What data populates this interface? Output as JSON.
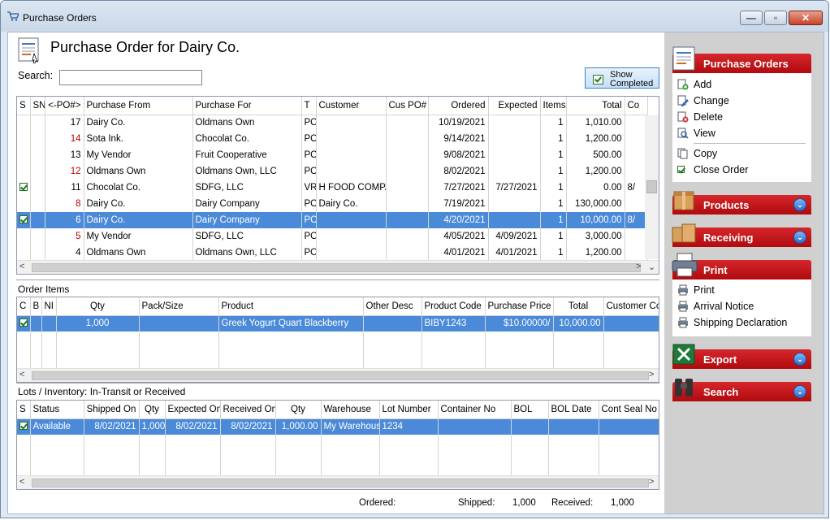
{
  "window": {
    "title": "Purchase Orders"
  },
  "header": {
    "title": "Purchase Order for Dairy Co."
  },
  "search": {
    "label": "Search:",
    "value": ""
  },
  "show_completed": {
    "label_line1": "Show",
    "label_line2": "Completed",
    "checked": true
  },
  "po_grid": {
    "columns": [
      "S",
      "SN",
      "<-PO#>",
      "Purchase From",
      "Purchase For",
      "T",
      "Customer",
      "Cus PO#",
      "Ordered",
      "Expected",
      "Items",
      "Total",
      "Co"
    ],
    "rows": [
      {
        "s": "",
        "sn": "",
        "po": "17",
        "from": "Dairy Co.",
        "for": "Oldmans Own",
        "t": "PO",
        "customer": "",
        "cuspo": "",
        "ordered": "10/19/2021",
        "expected": "",
        "items": "1",
        "total": "1,010.00",
        "co": "",
        "red": false,
        "checked": false,
        "selected": false
      },
      {
        "s": "",
        "sn": "",
        "po": "14",
        "from": "Sota Ink.",
        "for": "Chocolat Co.",
        "t": "PO",
        "customer": "",
        "cuspo": "",
        "ordered": "9/14/2021",
        "expected": "",
        "items": "1",
        "total": "1,200.00",
        "co": "",
        "red": true,
        "checked": false,
        "selected": false
      },
      {
        "s": "",
        "sn": "",
        "po": "13",
        "from": "My Vendor",
        "for": "Fruit Cooperative",
        "t": "PO",
        "customer": "",
        "cuspo": "",
        "ordered": "9/08/2021",
        "expected": "",
        "items": "1",
        "total": "500.00",
        "co": "",
        "red": false,
        "checked": false,
        "selected": false
      },
      {
        "s": "",
        "sn": "",
        "po": "12",
        "from": "Oldmans Own",
        "for": "Oldmans Own, LLC",
        "t": "PO",
        "customer": "",
        "cuspo": "",
        "ordered": "8/02/2021",
        "expected": "",
        "items": "1",
        "total": "1,200.00",
        "co": "",
        "red": true,
        "checked": false,
        "selected": false
      },
      {
        "s": "",
        "sn": "",
        "po": "11",
        "from": "Chocolat Co.",
        "for": "SDFG, LLC",
        "t": "VR",
        "customer": "H FOOD COMPA",
        "cuspo": "",
        "ordered": "7/27/2021",
        "expected": "7/27/2021",
        "items": "1",
        "total": "0.00",
        "co": "8/",
        "red": false,
        "checked": true,
        "selected": false
      },
      {
        "s": "",
        "sn": "",
        "po": "8",
        "from": "Dairy Co.",
        "for": "Dairy Company",
        "t": "PO",
        "customer": "Dairy Co.",
        "cuspo": "",
        "ordered": "7/19/2021",
        "expected": "",
        "items": "1",
        "total": "130,000.00",
        "co": "",
        "red": true,
        "checked": false,
        "selected": false
      },
      {
        "s": "",
        "sn": "",
        "po": "6",
        "from": "Dairy Co.",
        "for": "Dairy Company",
        "t": "PO",
        "customer": "",
        "cuspo": "",
        "ordered": "4/20/2021",
        "expected": "",
        "items": "1",
        "total": "10,000.00",
        "co": "8/",
        "red": false,
        "checked": true,
        "selected": true
      },
      {
        "s": "",
        "sn": "",
        "po": "5",
        "from": "My Vendor",
        "for": "SDFG, LLC",
        "t": "PO",
        "customer": "",
        "cuspo": "",
        "ordered": "4/05/2021",
        "expected": "4/09/2021",
        "items": "1",
        "total": "3,000.00",
        "co": "",
        "red": true,
        "checked": false,
        "selected": false
      },
      {
        "s": "",
        "sn": "",
        "po": "4",
        "from": "Oldmans Own",
        "for": "Oldmans Own, LLC",
        "t": "PO",
        "customer": "",
        "cuspo": "",
        "ordered": "4/01/2021",
        "expected": "4/01/2021",
        "items": "1",
        "total": "1,200.00",
        "co": "",
        "red": false,
        "checked": false,
        "selected": false
      }
    ]
  },
  "order_items": {
    "label": "Order Items",
    "columns": [
      "C",
      "B",
      "NI",
      "Qty",
      "Pack/Size",
      "Product",
      "Other Desc",
      "Product Code",
      "Purchase Price",
      "Total",
      "Customer Code"
    ],
    "rows": [
      {
        "c": "",
        "b": "",
        "ni": "",
        "qty": "1,000",
        "pack": "",
        "product": "Greek Yogurt Quart Blackberry",
        "other": "",
        "code": "BIBY1243",
        "price": "$10.00000/",
        "total": "10,000.00",
        "custcode": "",
        "checked": true,
        "selected": true
      }
    ]
  },
  "lots": {
    "label": "Lots / Inventory: In-Transit or Received",
    "columns": [
      "S",
      "Status",
      "Shipped On",
      "Qty",
      "Expected On",
      "Received On",
      "Qty",
      "Warehouse",
      "Lot Number",
      "Container No",
      "BOL",
      "BOL Date",
      "Cont Seal No"
    ],
    "rows": [
      {
        "status": "Available",
        "shipped": "8/02/2021",
        "qty": "1,000",
        "expected": "8/02/2021",
        "received": "8/02/2021",
        "qty2": "1,000.00",
        "warehouse": "My Warehouse",
        "lot": "1234",
        "container": "",
        "bol": "",
        "boldate": "",
        "seal": "",
        "checked": true,
        "selected": true
      }
    ]
  },
  "footer": {
    "ordered_label": "Ordered:",
    "ordered_value": "",
    "shipped_label": "Shipped:",
    "shipped_value": "1,000",
    "received_label": "Received:",
    "received_value": "1,000"
  },
  "sidebar": {
    "purchase_orders": {
      "title": "Purchase Orders",
      "items": [
        "Add",
        "Change",
        "Delete",
        "View",
        "Copy",
        "Close Order"
      ]
    },
    "products": {
      "title": "Products"
    },
    "receiving": {
      "title": "Receiving"
    },
    "print": {
      "title": "Print",
      "items": [
        "Print",
        "Arrival Notice",
        "Shipping Declaration"
      ]
    },
    "export": {
      "title": "Export"
    },
    "search": {
      "title": "Search"
    }
  },
  "colors": {
    "accent_red": "#c0161b",
    "selection": "#4a8ad8"
  }
}
